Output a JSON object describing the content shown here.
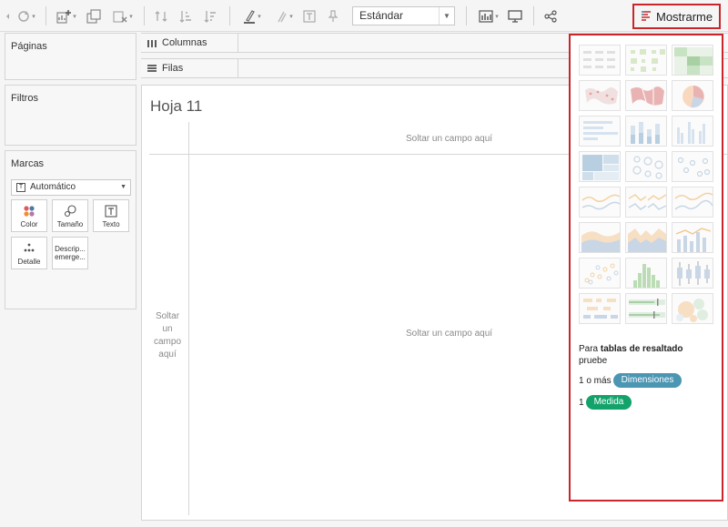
{
  "toolbar": {
    "fit_value": "Estándar",
    "show_me_label": "Mostrarme"
  },
  "panels": {
    "pages": "Páginas",
    "filters": "Filtros",
    "marks": {
      "title": "Marcas",
      "type": "Automático",
      "cards": [
        {
          "label": "Color",
          "icon": "color-icon"
        },
        {
          "label": "Tamaño",
          "icon": "size-icon"
        },
        {
          "label": "Texto",
          "icon": "text-icon"
        },
        {
          "label": "Detalle",
          "icon": "detail-icon"
        },
        {
          "label": "Descrip... emerge...",
          "icon": "tooltip-icon"
        }
      ]
    }
  },
  "shelves": {
    "columns": "Columnas",
    "rows": "Filas"
  },
  "sheet": {
    "title": "Hoja 11",
    "drop_top": "Soltar un campo aquí",
    "drop_center": "Soltar un campo aquí",
    "drop_left": "Soltar un campo aquí"
  },
  "show_me": {
    "hint_prefix": "Para ",
    "hint_bold": "tablas de resaltado",
    "hint_suffix": "pruebe",
    "req1_text": "1 o más",
    "req1_pill": "Dimensiones",
    "req2_text": "1",
    "req2_pill": "Medida",
    "colors": {
      "dimension": "#4b96b3",
      "measure": "#13a36a",
      "highlight": "#c8262b"
    },
    "chart_types": [
      "text-table",
      "heat-map",
      "highlight-table",
      "symbol-map",
      "filled-map",
      "pie-chart",
      "horizontal-bars",
      "stacked-bars",
      "side-by-side-bars",
      "treemap",
      "circle-views",
      "side-by-side-circles",
      "continuous-lines",
      "discrete-lines",
      "dual-lines",
      "continuous-area",
      "discrete-area",
      "dual-combination",
      "scatter-plot",
      "histogram",
      "box-and-whisker",
      "gantt-chart",
      "bullet-graph",
      "packed-bubbles"
    ]
  }
}
